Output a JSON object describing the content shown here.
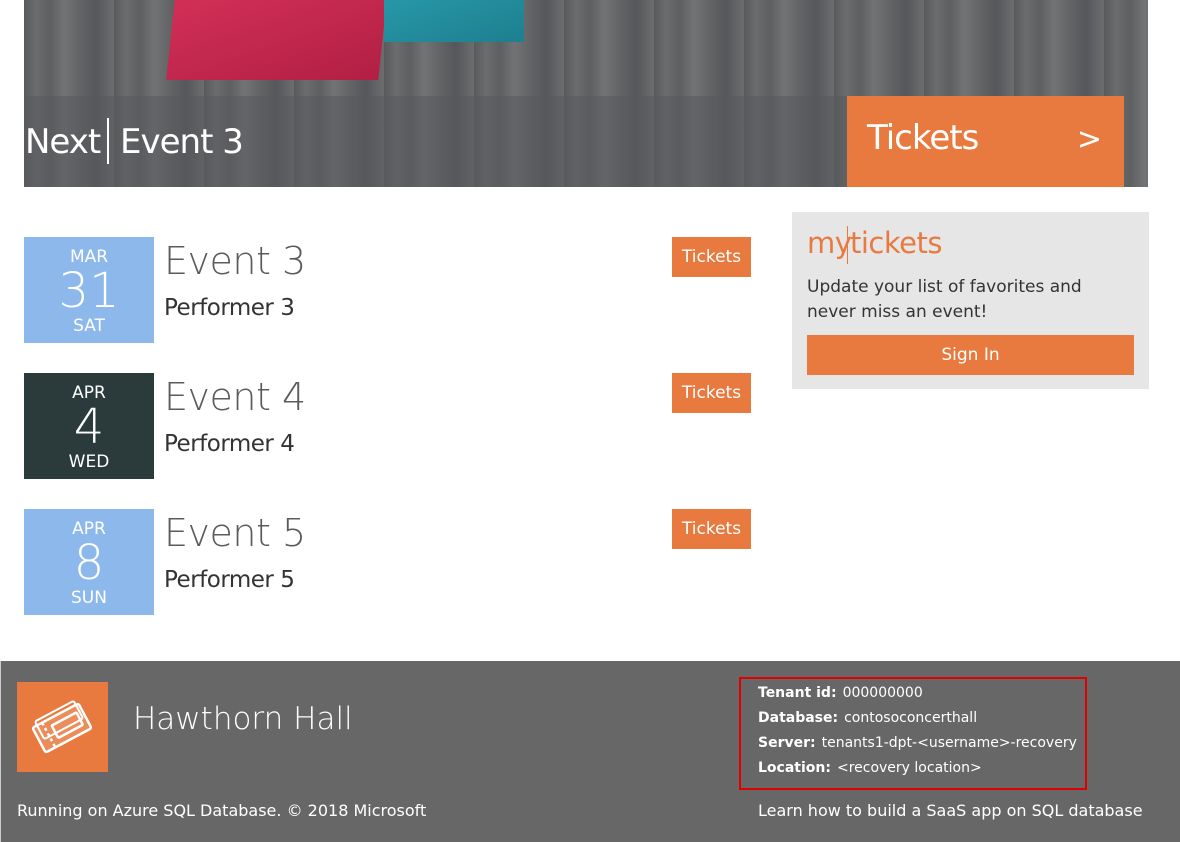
{
  "hero": {
    "next_label": "Next",
    "event_name": "Event 3",
    "tickets_label": "Tickets",
    "tickets_arrow": ">"
  },
  "events": [
    {
      "month": "MAR",
      "day": "31",
      "weekday": "SAT",
      "title": "Event 3",
      "performer": "Performer 3",
      "tickets_label": "Tickets",
      "color": "#8db8ec"
    },
    {
      "month": "APR",
      "day": "4",
      "weekday": "WED",
      "title": "Event 4",
      "performer": "Performer 4",
      "tickets_label": "Tickets",
      "color": "#2b3a3a"
    },
    {
      "month": "APR",
      "day": "8",
      "weekday": "SUN",
      "title": "Event 5",
      "performer": "Performer 5",
      "tickets_label": "Tickets",
      "color": "#8db8ec"
    }
  ],
  "mytickets": {
    "logo_a": "my",
    "logo_b": "tickets",
    "message": "Update your list of favorites and never miss an event!",
    "signin_label": "Sign In"
  },
  "footer": {
    "venue_name": "Hawthorn Hall",
    "copyright": "Running on Azure SQL Database. © 2018 Microsoft",
    "tenant_id_label": "Tenant id:",
    "tenant_id": "000000000",
    "database_label": "Database:",
    "database": "contosoconcerthall",
    "server_label": "Server:",
    "server": "tenants1-dpt-<username>-recovery",
    "location_label": "Location:",
    "location": "<recovery location>",
    "learn_link": "Learn how to build a SaaS app on SQL database"
  },
  "colors": {
    "accent": "#e87a3f",
    "footer_bg": "#676767",
    "highlight_border": "#e00000"
  }
}
